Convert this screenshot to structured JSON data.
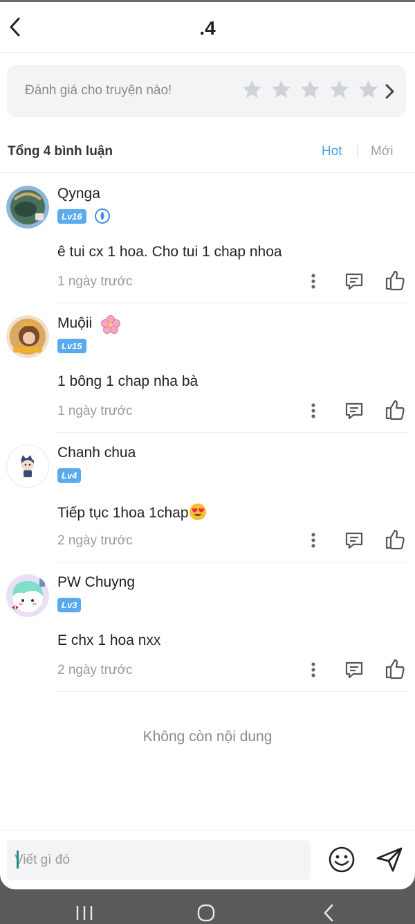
{
  "header": {
    "title": ".4"
  },
  "rating": {
    "prompt": "Đánh giá cho truyện nào!",
    "stars_filled": 0,
    "stars_total": 5
  },
  "comments_bar": {
    "total_label": "Tổng 4 bình luận",
    "sort_hot": "Hot",
    "sort_new": "Mới"
  },
  "comments": [
    {
      "username": "Qynga",
      "level": "Lv16",
      "text": "ê tui cx 1 hoa. Cho tui 1 chap nhoa",
      "time": "1 ngày trước"
    },
    {
      "username": "Muộii",
      "level": "Lv15",
      "text": "1 bông 1 chap nha bà",
      "time": "1 ngày trước"
    },
    {
      "username": "Chanh chua",
      "level": "Lv4",
      "text": "Tiếp tục 1hoa 1chap",
      "time": "2 ngày trước"
    },
    {
      "username": "PW Chuyng",
      "level": "Lv3",
      "text": "E chx 1 hoa nxx",
      "time": "2 ngày trước"
    }
  ],
  "end_text": "Không còn nội dung",
  "composer": {
    "placeholder": "Viết gì đó",
    "value": ""
  },
  "colors": {
    "accent": "#4a9ee8",
    "badge": "#5aaaee",
    "muted": "#9a9a9a",
    "box_bg": "#f3f4f6"
  },
  "icons": {
    "back": "chevron-left-icon",
    "star": "star-icon",
    "arrow": "chevron-right-icon",
    "more": "more-vertical-icon",
    "reply": "comment-icon",
    "like": "thumbs-up-icon",
    "emoji": "smiley-icon",
    "send": "send-icon"
  }
}
